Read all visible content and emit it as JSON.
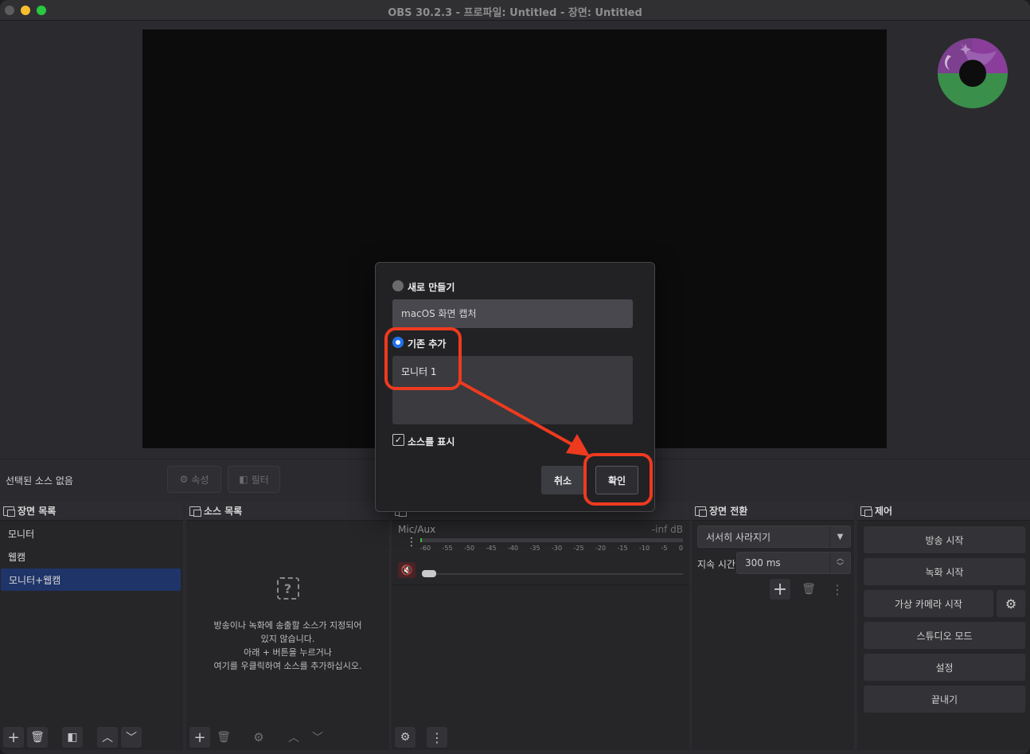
{
  "window": {
    "title": "OBS 30.2.3 - 프로파일: Untitled - 장면: Untitled"
  },
  "source_bar": {
    "no_source": "선택된 소스 없음",
    "properties_label": "속성",
    "filters_label": "필터"
  },
  "scenes": {
    "title": "장면 목록",
    "items": [
      {
        "label": "모니터"
      },
      {
        "label": "웹캠"
      },
      {
        "label": "모니터+웹캠"
      }
    ]
  },
  "sources": {
    "title": "소스 목록",
    "empty_lines": [
      "방송이나 녹화에 송출할 소스가 지정되어",
      "있지 않습니다.",
      "아래 + 버튼을 누르거나",
      "여기를 우클릭하여 소스를 추가하십시오."
    ]
  },
  "mixer": {
    "channel_name": "Mic/Aux",
    "level_text": "-inf dB",
    "ticks": [
      "-60",
      "-55",
      "-50",
      "-45",
      "-40",
      "-35",
      "-30",
      "-25",
      "-20",
      "-15",
      "-10",
      "-5",
      "0"
    ]
  },
  "transitions": {
    "title": "장면 전환",
    "selected": "서서히 사라지기",
    "duration_label": "지속 시간",
    "duration_value": "300 ms"
  },
  "controls": {
    "title": "제어",
    "buttons": [
      "방송 시작",
      "녹화 시작",
      "가상 카메라 시작",
      "스튜디오 모드",
      "설정",
      "끝내기"
    ]
  },
  "modal": {
    "create_new_label": "새로 만들기",
    "new_name_value": "macOS 화면 캡처",
    "add_existing_label": "기존 추가",
    "existing_items": [
      "모니터 1"
    ],
    "show_source_label": "소스를 표시",
    "show_source_checked": true,
    "selected_mode": "add_existing",
    "cancel_label": "취소",
    "ok_label": "확인"
  },
  "colors": {
    "accent": "#1f3468",
    "annotation": "#ee3a1f",
    "radio_active": "#1c6ef2"
  }
}
